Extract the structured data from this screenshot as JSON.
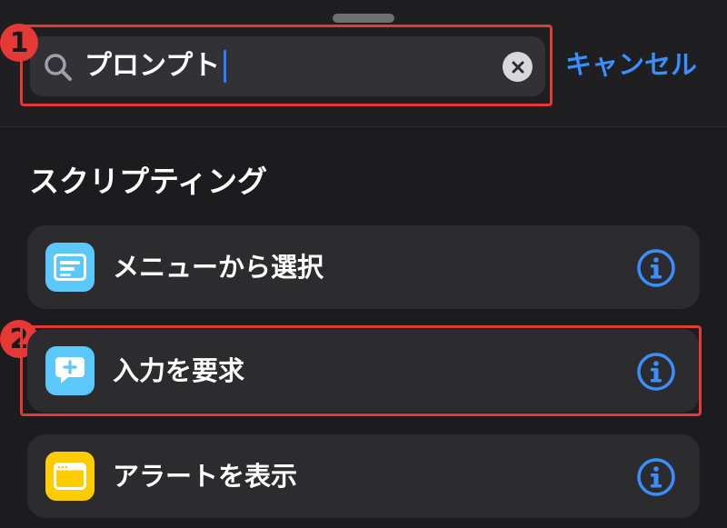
{
  "search": {
    "query": "プロンプト",
    "cancel_label": "キャンセル"
  },
  "annotations": {
    "marker_1": "1",
    "marker_2": "2"
  },
  "section": {
    "title": "スクリプティング"
  },
  "actions": [
    {
      "label": "メニューから選択",
      "icon": "menu-list-icon",
      "color": "#5ac8fa"
    },
    {
      "label": "入力を要求",
      "icon": "speech-bubble-plus-icon",
      "color": "#5ac8fa"
    },
    {
      "label": "アラートを表示",
      "icon": "alert-window-icon",
      "color": "#ffcc00"
    }
  ],
  "colors": {
    "accent": "#3a8eff",
    "highlight": "#e53935",
    "background": "#1c1c1e",
    "row": "#2c2c2e"
  }
}
